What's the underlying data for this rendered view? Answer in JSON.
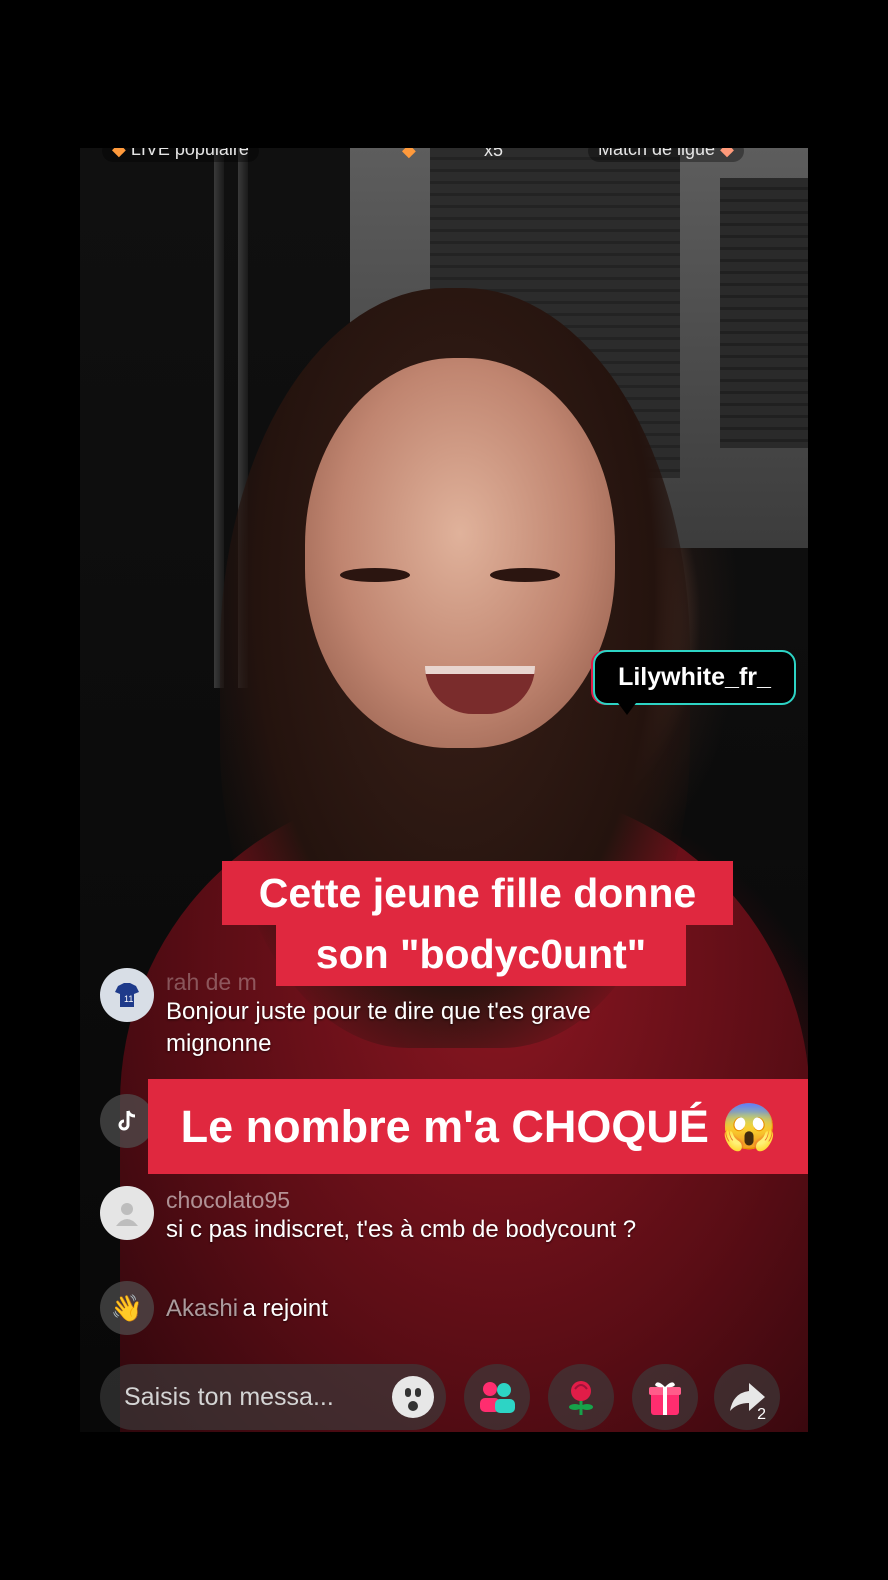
{
  "top_bar": {
    "live_label": "LIVE populaire",
    "count": "x5",
    "match_label": "Match de ligue"
  },
  "streamer": {
    "name": "Lilywhite_fr_"
  },
  "captions": {
    "line1": "Cette jeune fille donne",
    "line2": "son \"bodyc0unt\"",
    "line3": "Le nombre m'a CHOQUÉ 😱"
  },
  "chat": [
    {
      "user": "rah de m",
      "message_1": "Bonjour juste pour te dire que t'es grave",
      "message_2": "mignonne",
      "avatar_icon": "football-jersey-avatar"
    },
    {
      "user": "",
      "message_1": "",
      "avatar_icon": "tiktok-icon"
    },
    {
      "user": "chocolato95",
      "message_1": "si c pas indiscret, t'es à cmb de bodycount ?",
      "avatar_icon": "default-user-avatar"
    },
    {
      "user": "Akashi",
      "message_1": "a rejoint",
      "avatar_icon": "wave-hand-icon"
    }
  ],
  "bottom_bar": {
    "input_placeholder": "Saisis ton messa...",
    "share_count": "2",
    "icons": [
      "emoji-icon",
      "multi-guest-icon",
      "rose-gift-icon",
      "gift-icon",
      "share-icon"
    ]
  },
  "colors": {
    "caption_bg": "#e0283f",
    "nametag_border": "#2dd4c5",
    "gift_pink": "#ff2d6f"
  }
}
